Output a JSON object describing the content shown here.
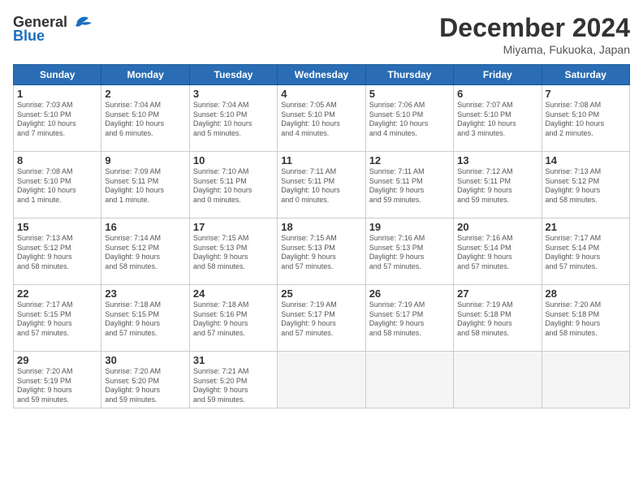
{
  "logo": {
    "general": "General",
    "blue": "Blue"
  },
  "title": "December 2024",
  "location": "Miyama, Fukuoka, Japan",
  "days_of_week": [
    "Sunday",
    "Monday",
    "Tuesday",
    "Wednesday",
    "Thursday",
    "Friday",
    "Saturday"
  ],
  "weeks": [
    [
      {
        "day": "1",
        "info": "Sunrise: 7:03 AM\nSunset: 5:10 PM\nDaylight: 10 hours\nand 7 minutes."
      },
      {
        "day": "2",
        "info": "Sunrise: 7:04 AM\nSunset: 5:10 PM\nDaylight: 10 hours\nand 6 minutes."
      },
      {
        "day": "3",
        "info": "Sunrise: 7:04 AM\nSunset: 5:10 PM\nDaylight: 10 hours\nand 5 minutes."
      },
      {
        "day": "4",
        "info": "Sunrise: 7:05 AM\nSunset: 5:10 PM\nDaylight: 10 hours\nand 4 minutes."
      },
      {
        "day": "5",
        "info": "Sunrise: 7:06 AM\nSunset: 5:10 PM\nDaylight: 10 hours\nand 4 minutes."
      },
      {
        "day": "6",
        "info": "Sunrise: 7:07 AM\nSunset: 5:10 PM\nDaylight: 10 hours\nand 3 minutes."
      },
      {
        "day": "7",
        "info": "Sunrise: 7:08 AM\nSunset: 5:10 PM\nDaylight: 10 hours\nand 2 minutes."
      }
    ],
    [
      {
        "day": "8",
        "info": "Sunrise: 7:08 AM\nSunset: 5:10 PM\nDaylight: 10 hours\nand 1 minute."
      },
      {
        "day": "9",
        "info": "Sunrise: 7:09 AM\nSunset: 5:11 PM\nDaylight: 10 hours\nand 1 minute."
      },
      {
        "day": "10",
        "info": "Sunrise: 7:10 AM\nSunset: 5:11 PM\nDaylight: 10 hours\nand 0 minutes."
      },
      {
        "day": "11",
        "info": "Sunrise: 7:11 AM\nSunset: 5:11 PM\nDaylight: 10 hours\nand 0 minutes."
      },
      {
        "day": "12",
        "info": "Sunrise: 7:11 AM\nSunset: 5:11 PM\nDaylight: 9 hours\nand 59 minutes."
      },
      {
        "day": "13",
        "info": "Sunrise: 7:12 AM\nSunset: 5:11 PM\nDaylight: 9 hours\nand 59 minutes."
      },
      {
        "day": "14",
        "info": "Sunrise: 7:13 AM\nSunset: 5:12 PM\nDaylight: 9 hours\nand 58 minutes."
      }
    ],
    [
      {
        "day": "15",
        "info": "Sunrise: 7:13 AM\nSunset: 5:12 PM\nDaylight: 9 hours\nand 58 minutes."
      },
      {
        "day": "16",
        "info": "Sunrise: 7:14 AM\nSunset: 5:12 PM\nDaylight: 9 hours\nand 58 minutes."
      },
      {
        "day": "17",
        "info": "Sunrise: 7:15 AM\nSunset: 5:13 PM\nDaylight: 9 hours\nand 58 minutes."
      },
      {
        "day": "18",
        "info": "Sunrise: 7:15 AM\nSunset: 5:13 PM\nDaylight: 9 hours\nand 57 minutes."
      },
      {
        "day": "19",
        "info": "Sunrise: 7:16 AM\nSunset: 5:13 PM\nDaylight: 9 hours\nand 57 minutes."
      },
      {
        "day": "20",
        "info": "Sunrise: 7:16 AM\nSunset: 5:14 PM\nDaylight: 9 hours\nand 57 minutes."
      },
      {
        "day": "21",
        "info": "Sunrise: 7:17 AM\nSunset: 5:14 PM\nDaylight: 9 hours\nand 57 minutes."
      }
    ],
    [
      {
        "day": "22",
        "info": "Sunrise: 7:17 AM\nSunset: 5:15 PM\nDaylight: 9 hours\nand 57 minutes."
      },
      {
        "day": "23",
        "info": "Sunrise: 7:18 AM\nSunset: 5:15 PM\nDaylight: 9 hours\nand 57 minutes."
      },
      {
        "day": "24",
        "info": "Sunrise: 7:18 AM\nSunset: 5:16 PM\nDaylight: 9 hours\nand 57 minutes."
      },
      {
        "day": "25",
        "info": "Sunrise: 7:19 AM\nSunset: 5:17 PM\nDaylight: 9 hours\nand 57 minutes."
      },
      {
        "day": "26",
        "info": "Sunrise: 7:19 AM\nSunset: 5:17 PM\nDaylight: 9 hours\nand 58 minutes."
      },
      {
        "day": "27",
        "info": "Sunrise: 7:19 AM\nSunset: 5:18 PM\nDaylight: 9 hours\nand 58 minutes."
      },
      {
        "day": "28",
        "info": "Sunrise: 7:20 AM\nSunset: 5:18 PM\nDaylight: 9 hours\nand 58 minutes."
      }
    ],
    [
      {
        "day": "29",
        "info": "Sunrise: 7:20 AM\nSunset: 5:19 PM\nDaylight: 9 hours\nand 59 minutes."
      },
      {
        "day": "30",
        "info": "Sunrise: 7:20 AM\nSunset: 5:20 PM\nDaylight: 9 hours\nand 59 minutes."
      },
      {
        "day": "31",
        "info": "Sunrise: 7:21 AM\nSunset: 5:20 PM\nDaylight: 9 hours\nand 59 minutes."
      },
      null,
      null,
      null,
      null
    ]
  ]
}
